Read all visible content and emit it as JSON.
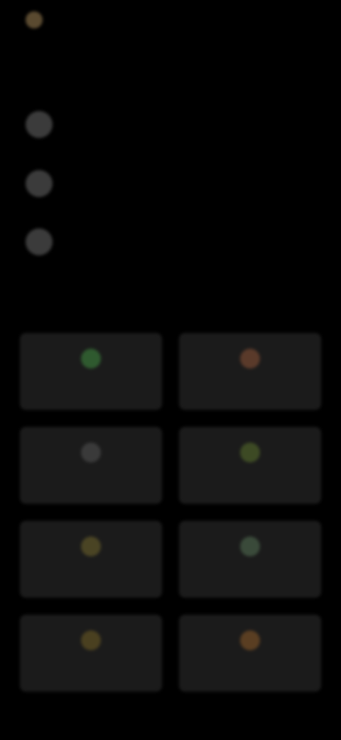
{
  "header": {
    "app_name": "",
    "tabs": [
      "",
      ""
    ]
  },
  "rows": [
    {
      "icon": "circle-icon",
      "label": ""
    },
    {
      "icon": "circle-icon",
      "label": ""
    },
    {
      "icon": "circle-icon",
      "label": ""
    }
  ],
  "section": {
    "title": ""
  },
  "cards": [
    {
      "icon": "leaf-icon",
      "color": "#2f5a2f",
      "label": ""
    },
    {
      "icon": "flame-icon",
      "color": "#5a3a2a",
      "label": ""
    },
    {
      "icon": "moon-icon",
      "color": "#3a3a3a",
      "label": ""
    },
    {
      "icon": "sprout-icon",
      "color": "#3d4a24",
      "label": ""
    },
    {
      "icon": "star-icon",
      "color": "#4a4424",
      "label": ""
    },
    {
      "icon": "drop-icon",
      "color": "#3a4a3a",
      "label": ""
    },
    {
      "icon": "bell-icon",
      "color": "#4a4020",
      "label": ""
    },
    {
      "icon": "sun-icon",
      "color": "#5a3e22",
      "label": ""
    }
  ],
  "colors": {
    "background": "#000000",
    "card": "#1b1b1b",
    "row_icon": "#3b3b3b"
  }
}
